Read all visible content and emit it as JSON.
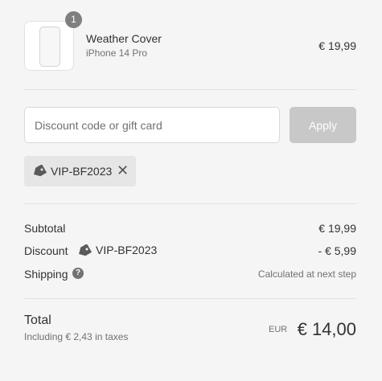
{
  "product": {
    "quantity": "1",
    "title": "Weather Cover",
    "variant": "iPhone 14 Pro",
    "price": "€ 19,99",
    "thumbnail_icon": "phone-case-icon"
  },
  "discount": {
    "placeholder": "Discount code or gift card",
    "apply_label": "Apply",
    "applied_code": "VIP-BF2023",
    "tag_icon": "tag-icon",
    "remove_icon": "close-icon",
    "remove_glyph": "✕"
  },
  "summary": {
    "subtotal_label": "Subtotal",
    "subtotal_value": "€ 19,99",
    "discount_label": "Discount",
    "discount_code": "VIP-BF2023",
    "discount_value": "- € 5,99",
    "shipping_label": "Shipping",
    "shipping_help_glyph": "?",
    "shipping_value": "Calculated at next step",
    "total_label": "Total",
    "tax_note": "Including € 2,43 in taxes",
    "currency": "EUR",
    "total_value": "€ 14,00"
  },
  "colors": {
    "background": "#f5f5f5",
    "apply_disabled": "#c8c8c8",
    "chip": "#e6e6e6",
    "badge": "#7f7f7f"
  }
}
